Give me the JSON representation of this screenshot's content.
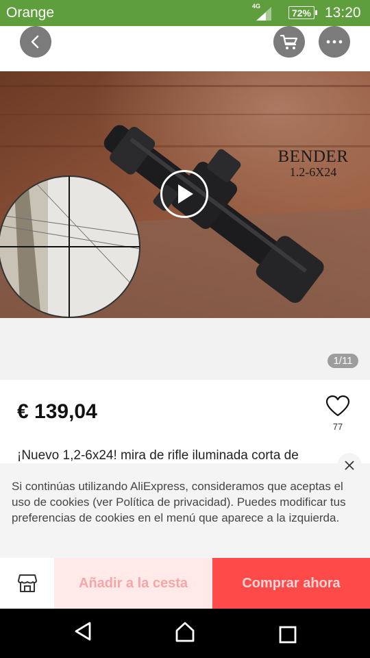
{
  "status_bar": {
    "carrier": "Orange",
    "network": "4G",
    "battery": "72%",
    "time": "13:20",
    "bg_color": "#5f9e3c"
  },
  "nav": {
    "back_icon": "chevron-left-icon",
    "cart_icon": "cart-icon",
    "more_icon": "more-dots-icon"
  },
  "media": {
    "brand": "BENDER",
    "model": "1.2-6X24",
    "play_icon": "play-icon",
    "counter": "1/11"
  },
  "product": {
    "price": "€ 139,04",
    "wishlist_count": "77",
    "title": "¡Nuevo 1,2-6x24! mira de rifle iluminada corta de"
  },
  "cookie_banner": {
    "text": "Si continúas utilizando AliExpress, consideramos que aceptas el uso de cookies (ver Política de privacidad). Puedes modificar tus preferencias de cookies en el menú que aparece a la izquierda."
  },
  "actions": {
    "store_icon": "store-icon",
    "add_to_cart": "Añadir a la cesta",
    "buy_now": "Comprar ahora",
    "accent_color": "#ff4a4a"
  }
}
